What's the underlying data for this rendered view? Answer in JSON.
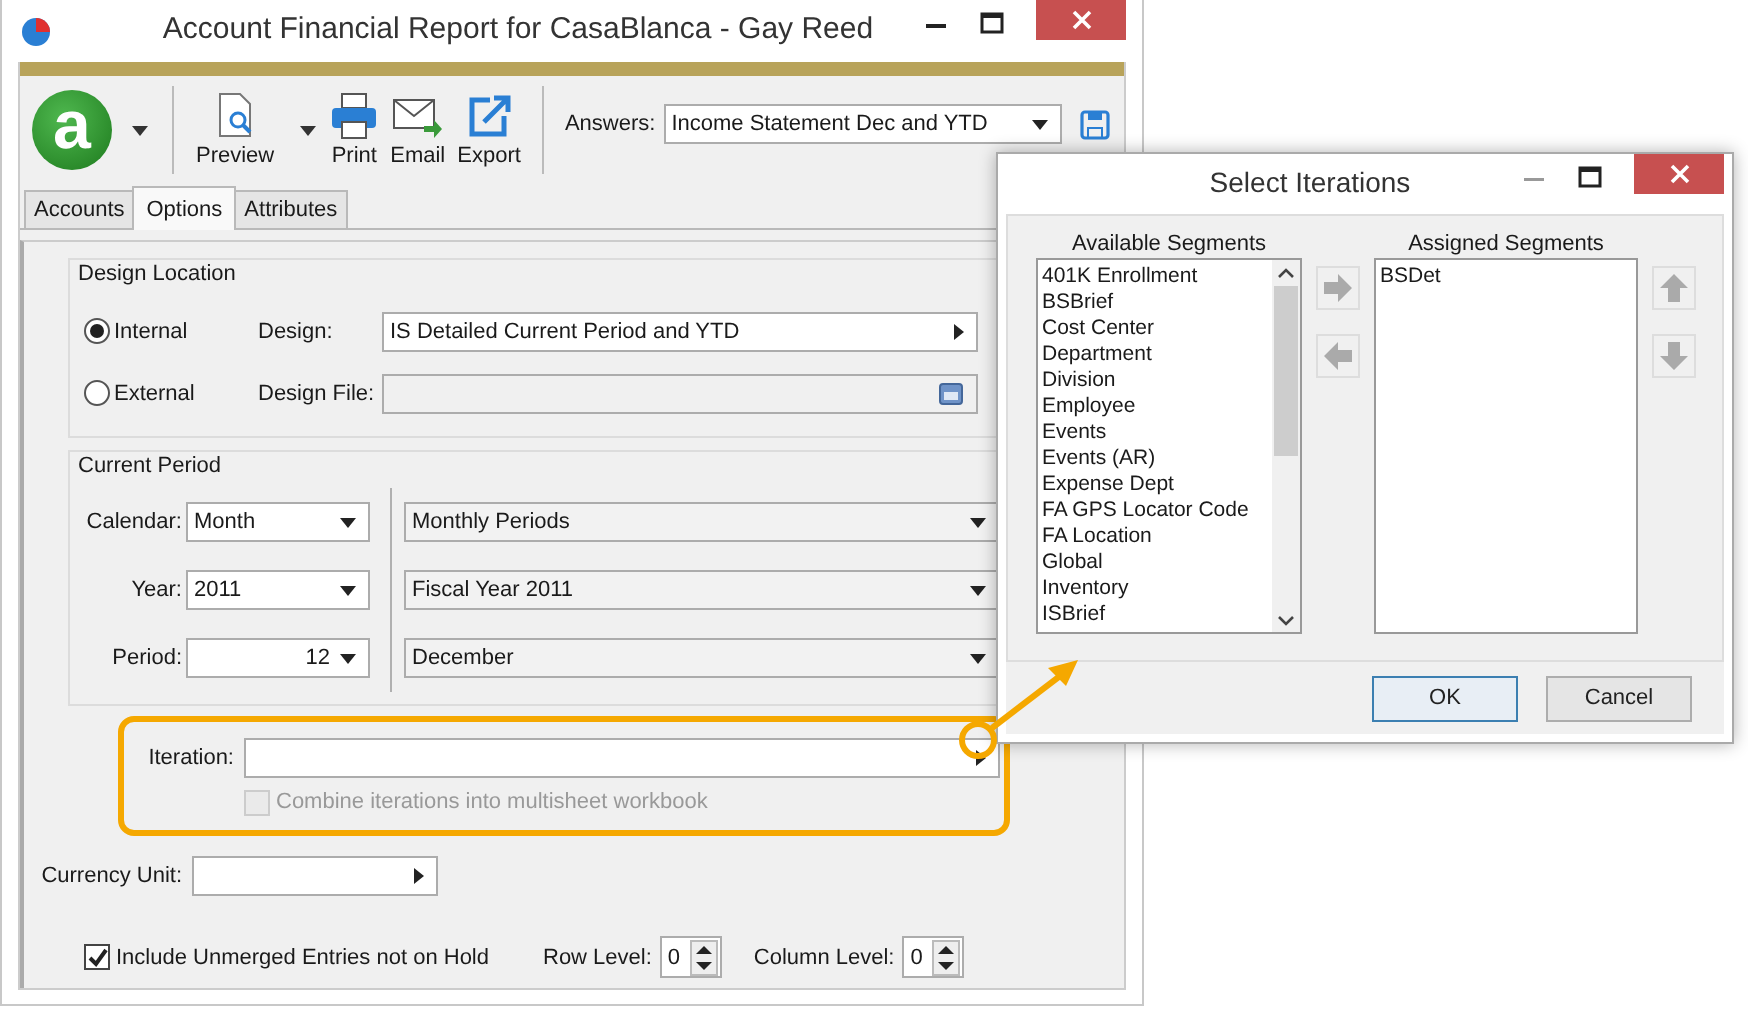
{
  "window": {
    "title": "Account Financial Report for CasaBlanca - Gay Reed"
  },
  "toolbar": {
    "logo_letter": "a",
    "buttons": [
      {
        "label": "Preview",
        "kind": "preview"
      },
      {
        "label": "Print",
        "kind": "print"
      },
      {
        "label": "Email",
        "kind": "email"
      },
      {
        "label": "Export",
        "kind": "export"
      }
    ],
    "answers_label": "Answers:",
    "answers_value": "Income Statement Dec and YTD"
  },
  "tabs": [
    {
      "label": "Accounts",
      "selected": false
    },
    {
      "label": "Options",
      "selected": true
    },
    {
      "label": "Attributes",
      "selected": false
    }
  ],
  "design_location": {
    "title": "Design Location",
    "options": [
      {
        "label": "Internal",
        "selected": true
      },
      {
        "label": "External",
        "selected": false
      }
    ],
    "design_label": "Design:",
    "design_value": "IS Detailed Current Period and YTD",
    "design_file_label": "Design File:"
  },
  "current_period": {
    "title": "Current Period",
    "rows": [
      {
        "label": "Calendar:",
        "value": "Month",
        "kind": "text",
        "detail": "Monthly Periods"
      },
      {
        "label": "Year:",
        "value": "2011",
        "kind": "text",
        "detail": "Fiscal Year 2011"
      },
      {
        "label": "Period:",
        "value": "12",
        "kind": "number",
        "detail": "December"
      }
    ]
  },
  "iteration": {
    "label": "Iteration:",
    "highlighted": true,
    "combine": {
      "label": "Combine iterations into multisheet workbook",
      "checked": false,
      "disabled": true
    }
  },
  "currency_unit": {
    "label": "Currency Unit:"
  },
  "include_unmerged": {
    "label": "Include Unmerged Entries not on Hold",
    "checked": true
  },
  "levels": [
    {
      "label": "Row Level:",
      "value": "0"
    },
    {
      "label": "Column Level:",
      "value": "0"
    }
  ],
  "dialog": {
    "title": "Select Iterations",
    "available": {
      "title": "Available Segments",
      "items": [
        "401K Enrollment",
        "BSBrief",
        "Cost Center",
        "Department",
        "Division",
        "Employee",
        "Events",
        "Events (AR)",
        "Expense Dept",
        "FA GPS Locator Code",
        "FA Location",
        "Global",
        "Inventory",
        "ISBrief"
      ]
    },
    "assigned": {
      "title": "Assigned Segments",
      "items": [
        "BSDet"
      ]
    },
    "buttons": [
      {
        "label": "OK",
        "default": true
      },
      {
        "label": "Cancel",
        "default": false
      }
    ]
  }
}
